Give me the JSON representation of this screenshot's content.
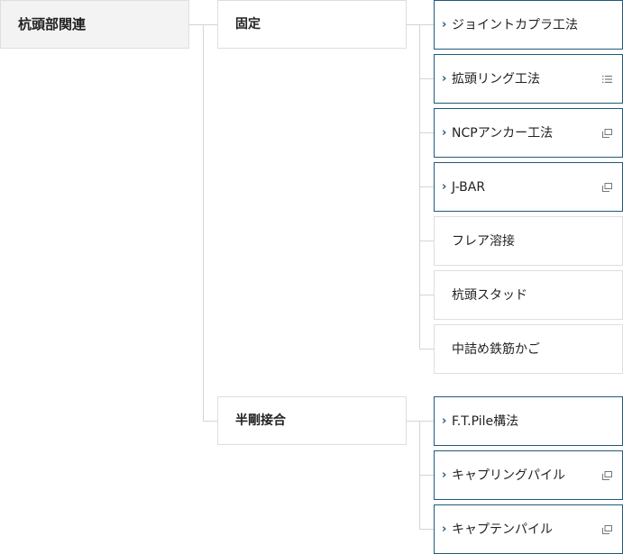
{
  "root": {
    "label": "杭頭部関連"
  },
  "groups": [
    {
      "label": "固定",
      "items": [
        {
          "label": "ジョイントカプラ工法",
          "linked": true,
          "badge": ""
        },
        {
          "label": "拡頭リング工法",
          "linked": true,
          "badge": "list-icon"
        },
        {
          "label": "NCPアンカー工法",
          "linked": true,
          "badge": "external-window-icon"
        },
        {
          "label": "J-BAR",
          "linked": true,
          "badge": "external-window-icon"
        },
        {
          "label": "フレア溶接",
          "linked": false,
          "badge": ""
        },
        {
          "label": "杭頭スタッド",
          "linked": false,
          "badge": ""
        },
        {
          "label": "中詰め鉄筋かご",
          "linked": false,
          "badge": ""
        }
      ]
    },
    {
      "label": "半剛接合",
      "items": [
        {
          "label": "F.T.Pile構法",
          "linked": true,
          "badge": ""
        },
        {
          "label": "キャプリングパイル",
          "linked": true,
          "badge": "external-window-icon"
        },
        {
          "label": "キャプテンパイル",
          "linked": true,
          "badge": "external-window-icon"
        }
      ]
    }
  ],
  "colors": {
    "link_border": "#1f5a7a",
    "plain_border": "#dedede",
    "root_bg": "#f3f3f3",
    "connector": "#d4d4d4"
  }
}
